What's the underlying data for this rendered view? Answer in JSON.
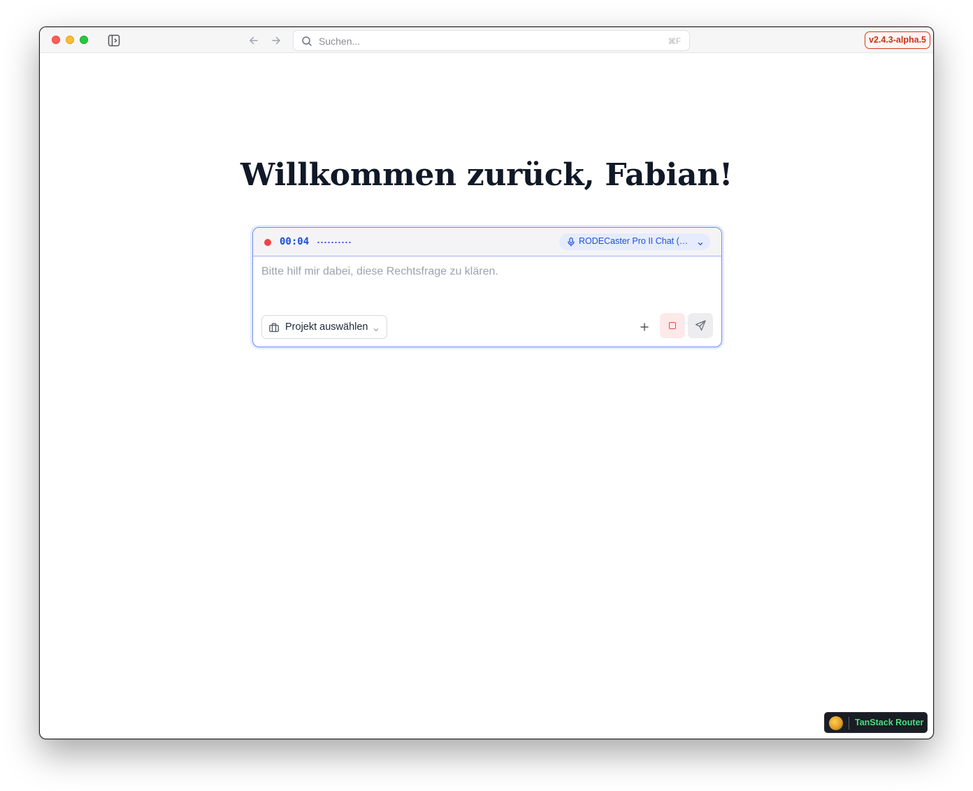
{
  "titlebar": {
    "search_placeholder": "Suchen...",
    "search_shortcut": "⌘F",
    "version": "v2.4.3-alpha.5"
  },
  "main": {
    "greeting": "Willkommen zurück, Fabian!"
  },
  "composer": {
    "recording_time": "00:04",
    "recording_indicator_color": "#ef4444",
    "microphone_device": "RODECaster Pro II Chat (19f...",
    "prompt_placeholder": "Bitte hilf mir dabei, diese Rechtsfrage zu klären.",
    "project_label": "Projekt auswählen",
    "icons": [
      "mic-icon",
      "briefcase-icon",
      "plus-icon",
      "stop-icon",
      "send-icon"
    ]
  },
  "devtools": {
    "tanstack_label": "TanStack Router"
  },
  "colors": {
    "accent_blue": "#1d4ed8",
    "version_red": "#c8321a",
    "tanstack_green": "#4ade80"
  }
}
